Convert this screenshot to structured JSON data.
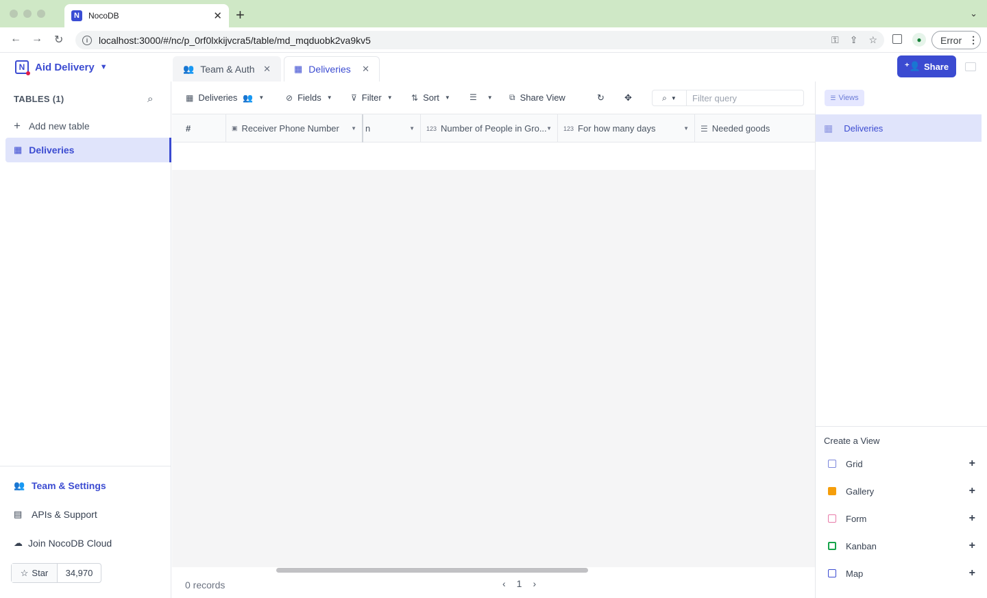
{
  "browser": {
    "tab_title": "NocoDB",
    "tab_favicon": "N",
    "url": "localhost:3000/#/nc/p_0rf0lxkijvcra5/table/md_mqduobk2va9kv5",
    "error_label": "Error"
  },
  "app": {
    "project_name": "Aid Delivery",
    "tabs": [
      {
        "label": "Team & Auth",
        "icon": "team-icon"
      },
      {
        "label": "Deliveries",
        "icon": "grid-icon"
      }
    ],
    "share_label": "Share"
  },
  "sidebar": {
    "tables_heading": "TABLES (1)",
    "add_table_label": "Add new table",
    "tables": [
      {
        "label": "Deliveries"
      }
    ],
    "bottom_links": [
      {
        "label": "Team & Settings"
      },
      {
        "label": "APIs & Support"
      },
      {
        "label": "Join NocoDB Cloud"
      }
    ],
    "star_label": "Star",
    "star_count": "34,970"
  },
  "toolbar": {
    "view_name": "Deliveries",
    "fields_label": "Fields",
    "filter_label": "Filter",
    "sort_label": "Sort",
    "share_view_label": "Share View",
    "search_placeholder": "Filter query"
  },
  "grid": {
    "columns": [
      {
        "label": "#"
      },
      {
        "label": "Receiver Phone Number"
      },
      {
        "label": "n"
      },
      {
        "label": "Number of People in Gro..."
      },
      {
        "label": "For how many days"
      },
      {
        "label": "Needed goods"
      }
    ],
    "records_label": "0 records",
    "current_page": "1"
  },
  "views_panel": {
    "chip_label": "Views",
    "active_view": "Deliveries",
    "create_heading": "Create a View",
    "create_items": [
      {
        "label": "Grid",
        "color": "#7b86db"
      },
      {
        "label": "Gallery",
        "color": "#f59e0b"
      },
      {
        "label": "Form",
        "color": "#e879a8"
      },
      {
        "label": "Kanban",
        "color": "#16a34a"
      },
      {
        "label": "Map",
        "color": "#3b4bd1"
      }
    ]
  }
}
